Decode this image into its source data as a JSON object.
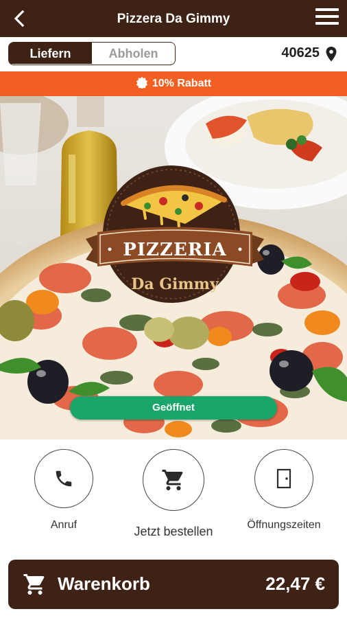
{
  "header": {
    "title": "Pizzera Da Gimmy",
    "back_icon": "chevron-left-icon",
    "menu_icon": "hamburger-menu-icon"
  },
  "mode_toggle": {
    "options": [
      {
        "label": "Liefern",
        "active": true
      },
      {
        "label": "Abholen",
        "active": false
      }
    ]
  },
  "location": {
    "postal_code": "40625",
    "icon": "location-pin-icon"
  },
  "discount_banner": {
    "text": "10% Rabatt",
    "icon": "discount-badge-icon"
  },
  "restaurant": {
    "logo": {
      "line1": "PIZZERIA",
      "line2": "Da Gimmy"
    },
    "status": "Geöffnet"
  },
  "actions": [
    {
      "label": "Anruf",
      "icon": "phone-icon"
    },
    {
      "label": "Jetzt bestellen",
      "icon": "shopping-cart-icon"
    },
    {
      "label": "Öffnungszeiten",
      "icon": "door-icon"
    }
  ],
  "cart": {
    "label": "Warenkorb",
    "total": "22,47 €",
    "icon": "shopping-cart-icon"
  },
  "colors": {
    "primary_brown": "#3e2215",
    "discount_orange": "#f16022",
    "status_green": "#1aa66a"
  }
}
